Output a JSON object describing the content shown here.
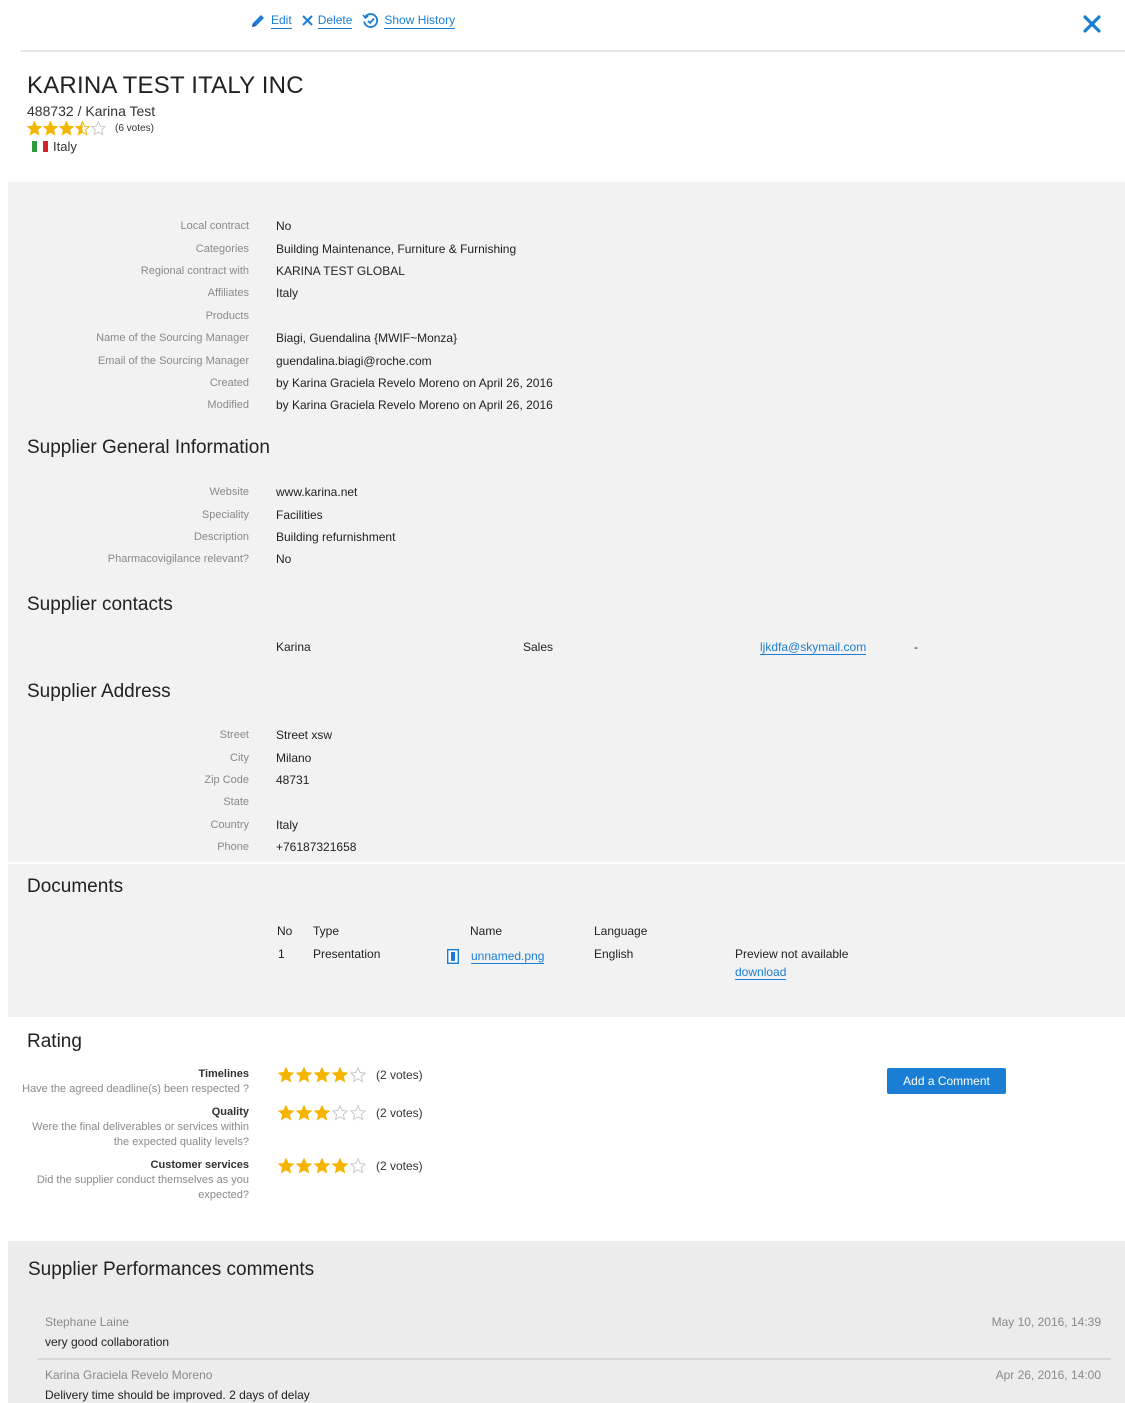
{
  "toolbar": {
    "edit_label": "Edit",
    "delete_label": "Delete",
    "history_label": "Show History",
    "close_icon": "close-icon"
  },
  "supplier": {
    "name": "KARINA TEST ITALY INC",
    "id_line": "488732 / Karina Test",
    "rating": 3.5,
    "rating_max": 5,
    "votes_label": "(6 votes)",
    "country": "Italy"
  },
  "contract": [
    {
      "label": "Local contract",
      "value": "No"
    },
    {
      "label": "Categories",
      "value": "Building Maintenance, Furniture & Furnishing"
    },
    {
      "label": "Regional contract with",
      "value": "KARINA TEST GLOBAL"
    },
    {
      "label": "Affiliates",
      "value": "Italy"
    },
    {
      "label": "Products",
      "value": ""
    },
    {
      "label": "Name of the Sourcing Manager",
      "value": "Biagi, Guendalina {MWIF~Monza}"
    },
    {
      "label": "Email of the Sourcing Manager",
      "value": "guendalina.biagi@roche.com"
    },
    {
      "label": "Created",
      "value": "by Karina Graciela Revelo Moreno on April 26, 2016"
    },
    {
      "label": "Modified",
      "value": "by Karina Graciela Revelo Moreno on April 26, 2016"
    }
  ],
  "general": {
    "title": "Supplier General Information",
    "rows": [
      {
        "label": "Website",
        "value": "www.karina.net"
      },
      {
        "label": "Speciality",
        "value": "Facilities"
      },
      {
        "label": "Description",
        "value": "Building refurnishment"
      },
      {
        "label": "Pharmacovigilance relevant?",
        "value": "No"
      }
    ]
  },
  "contacts": {
    "title": "Supplier contacts",
    "items": [
      {
        "name": "Karina",
        "role": "Sales",
        "email": "ljkdfa@skymail.com",
        "phone": "-"
      }
    ]
  },
  "address": {
    "title": "Supplier Address",
    "rows": [
      {
        "label": "Street",
        "value": "Street xsw"
      },
      {
        "label": "City",
        "value": "Milano"
      },
      {
        "label": "Zip Code",
        "value": "48731"
      },
      {
        "label": "State",
        "value": ""
      },
      {
        "label": "Country",
        "value": "Italy"
      },
      {
        "label": "Phone",
        "value": "+76187321658"
      }
    ]
  },
  "documents": {
    "title": "Documents",
    "headers": {
      "no": "No",
      "type": "Type",
      "name": "Name",
      "language": "Language"
    },
    "rows": [
      {
        "no": "1",
        "type": "Presentation",
        "name": "unnamed.png",
        "language": "English",
        "preview": "Preview not available",
        "download": "download"
      }
    ]
  },
  "rating": {
    "title": "Rating",
    "add_comment_label": "Add a Comment",
    "criteria": [
      {
        "name": "Timelines",
        "desc": "Have the agreed deadline(s) been respected ?",
        "score": 4,
        "votes": "(2 votes)"
      },
      {
        "name": "Quality",
        "desc": "Were the final deliverables or services within the expected quality levels?",
        "score": 3,
        "votes": "(2 votes)"
      },
      {
        "name": "Customer services",
        "desc": "Did the supplier conduct themselves as you expected?",
        "score": 4,
        "votes": "(2 votes)"
      }
    ]
  },
  "comments": {
    "title": "Supplier Performances comments",
    "items": [
      {
        "author": "Stephane Laine",
        "text": "very good collaboration",
        "date": "May 10, 2016, 14:39"
      },
      {
        "author": "Karina Graciela Revelo Moreno",
        "text": "Delivery time should be improved. 2 days of delay",
        "date": "Apr 26, 2016, 14:00"
      }
    ]
  },
  "colors": {
    "accent": "#1a7fd4",
    "star": "#f5b400",
    "star_empty": "#c8c8c8"
  }
}
